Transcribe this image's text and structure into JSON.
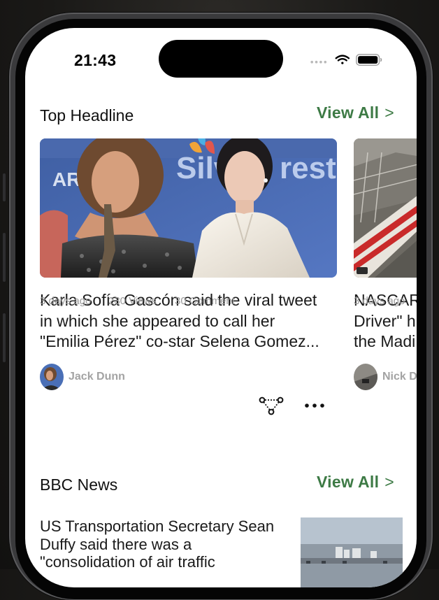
{
  "status_bar": {
    "time": "21:43"
  },
  "top_headline": {
    "title": "Top Headline",
    "view_all": "View All",
    "cards": [
      {
        "image_sign_texts": [
          "AR",
          "Silv",
          "rest"
        ],
        "title": "Karla Sofía Gascón said the viral tweet\nin which she appeared to call her\n\"Emilia Pérez\" co-star Selena Gomez...",
        "author": "Jack Dunn",
        "time_ago": "3 days ago",
        "views": "230 Views",
        "comments": "30 Comment"
      },
      {
        "title": "NASCAR\nDriver\" h\nthe Madi",
        "author": "Nick D",
        "time_ago": "3 days ago"
      }
    ]
  },
  "bbc_news": {
    "title": "BBC News",
    "view_all": "View All",
    "items": [
      {
        "text": "US Transportation Secretary Sean\nDuffy said there was a\n\"consolidation of air traffic"
      }
    ]
  },
  "icons": {
    "chevron": ">",
    "share": "share-icon",
    "more": "more-dots-icon",
    "signal": "cellular-signal-icon",
    "wifi": "wifi-icon",
    "battery": "battery-icon"
  },
  "colors": {
    "accent": "#3d7a45",
    "meta_text": "#9b9b9b",
    "author_text": "#a3a3a3"
  }
}
